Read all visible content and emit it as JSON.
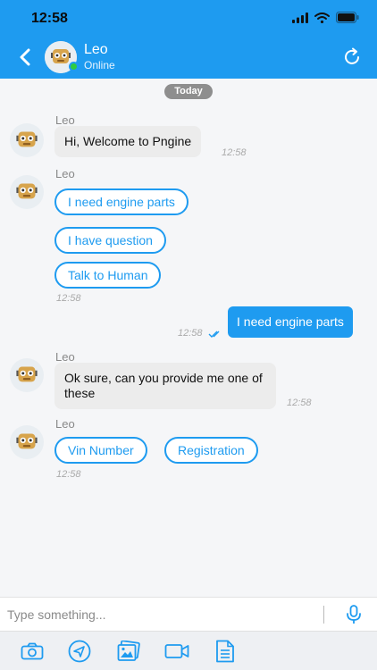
{
  "status_bar": {
    "time": "12:58"
  },
  "header": {
    "contact_name": "Leo",
    "contact_status": "Online"
  },
  "chat": {
    "date_separator": "Today",
    "messages": [
      {
        "sender": "Leo",
        "text": "Hi, Welcome to Pngine",
        "time": "12:58"
      },
      {
        "sender": "Leo",
        "options": [
          "I need engine parts",
          "I have question",
          "Talk to Human"
        ],
        "time": "12:58"
      },
      {
        "sender": "me",
        "text": "I need engine parts",
        "time": "12:58"
      },
      {
        "sender": "Leo",
        "text": "Ok sure, can you provide me one of these",
        "time": "12:58"
      },
      {
        "sender": "Leo",
        "options": [
          "Vin Number",
          "Registration"
        ],
        "time": "12:58"
      }
    ]
  },
  "composer": {
    "placeholder": "Type something..."
  },
  "toolbar": {
    "items": [
      "camera-icon",
      "send-location-icon",
      "gallery-icon",
      "video-icon",
      "document-icon"
    ]
  },
  "colors": {
    "accent": "#1e9bf0",
    "online": "#2ecc40",
    "incoming_bubble": "#ececec"
  }
}
